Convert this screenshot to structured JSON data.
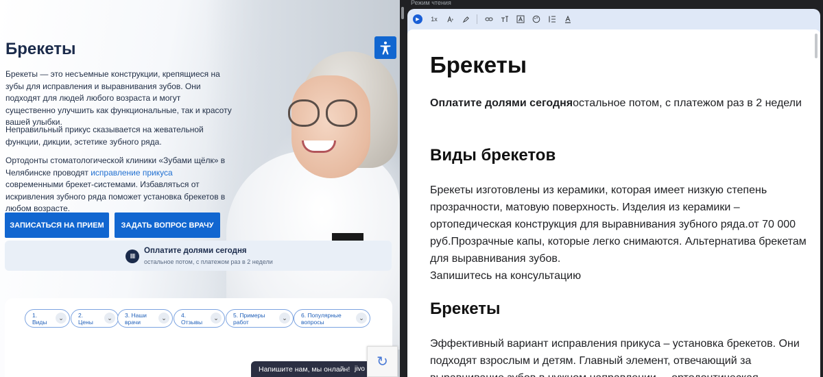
{
  "page": {
    "title": "Брекеты",
    "para1": "Брекеты — это несъемные конструкции, крепящиеся на зубы для исправления и выравнивания зубов. Они подходят для людей любого возраста и могут существенно улучшить как функциональные, так и красоту вашей улыбки.",
    "para2": "Неправильный прикус сказывается на жевательной функции, дикции, эстетике зубного ряда.",
    "para3_a": "Ортодонты стоматологической клиники «Зубами щёлк» в Челябинске проводят ",
    "para3_link": "исправление прикуса",
    "para3_b": " современными брекет-системами. Избавляться от искривления зубного ряда поможет установка брекетов в любом возрасте.",
    "btn_appointment": "Записаться на прием",
    "btn_ask": "Задать вопрос врачу",
    "pay_icon": "IIII",
    "pay_title": "Оплатите долями сегодня",
    "pay_subtitle": "остальное потом, с платежом раз в 2 недели",
    "tabs": [
      {
        "label": "1. Виды"
      },
      {
        "label": "2. Цены"
      },
      {
        "label": "3. Наши врачи"
      },
      {
        "label": "4. Отзывы"
      },
      {
        "label": "5. Примеры работ"
      },
      {
        "label": "6. Популярные вопросы"
      }
    ],
    "chat_text": "Напишите нам, мы онлайн!",
    "chat_brand": "jivo"
  },
  "reader": {
    "header_title": "Режим чтения",
    "toolbar": {
      "speed": "1x"
    },
    "h1": "Брекеты",
    "p1_bold": "Оплатите долями сегодня",
    "p1_rest": "остальное потом, с платежом раз в 2 недели",
    "h2_1": "Виды брекетов",
    "p2": "Брекеты изготовлены из керамики, которая имеет низкую степень прозрачности, матовую поверхность. Изделия из керамики – ортопедическая конструкция для выравнивания зубного ряда.от 70 000 руб.Прозрачные капы, которые легко снимаются. Альтернатива брекетам для выравнивания зубов.",
    "p2_cta": "Запишитесь на консультацию",
    "h2_2": "Брекеты",
    "p3": "Эффективный вариант исправления прикуса – установка брекетов. Они подходят взрослым и детям. Главный элемент, отвечающий за выравнивание зубов в нужном направлении, – ортодонтическая"
  },
  "colors": {
    "brand_blue": "#1166d0",
    "heading": "#1b2b4b",
    "reader_bg": "#dfe8f7"
  },
  "icons": [
    "accessibility-icon",
    "chevron-down-icon",
    "recaptcha-icon",
    "play-icon",
    "link-icon",
    "text-size-icon",
    "font-icon",
    "palette-icon",
    "line-spacing-icon",
    "text-color-icon"
  ]
}
